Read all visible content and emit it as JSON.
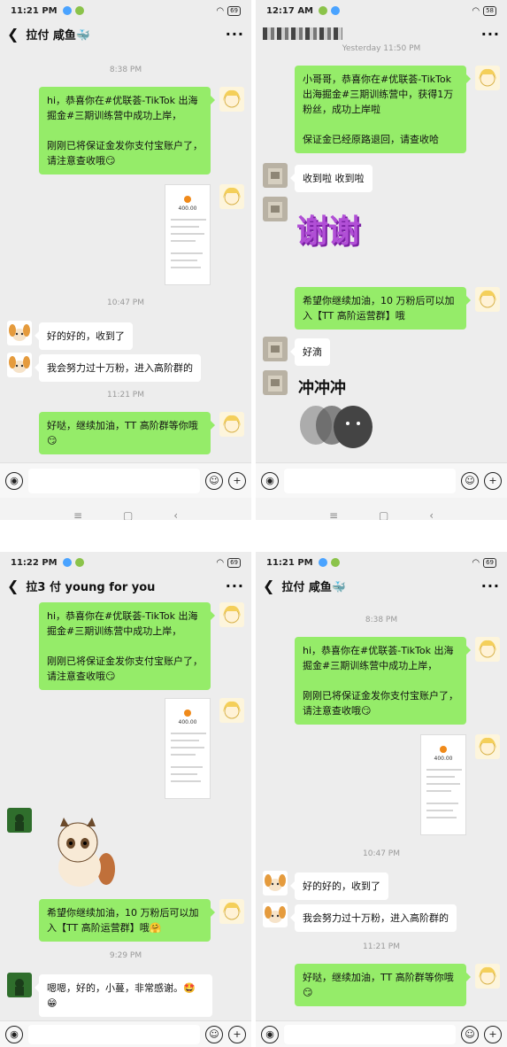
{
  "panel1": {
    "time": "11:21 PM",
    "battery": "69",
    "title": "拉付 咸鱼🐳",
    "ts1": "8:38 PM",
    "msg1_line1": "hi，恭喜你在#优联荟-TikTok 出海掘金#三期训练营中成功上岸，",
    "msg1_line2": "刚刚已将保证金发你支付宝账户了，请注意查收哦😏",
    "shot_amount": "400.00",
    "ts2": "10:47 PM",
    "reply1": "好的好的，收到了",
    "reply2": "我会努力过十万粉，进入高阶群的",
    "ts3": "11:21 PM",
    "msg2": "好哒，继续加油，TT 高阶群等你哦😏"
  },
  "panel2": {
    "time": "12:17 AM",
    "battery": "58",
    "ts0": "Yesterday 11:50 PM",
    "msg1_line1": "小哥哥，恭喜你在#优联荟-TikTok 出海掘金#三期训练营中，获得1万粉丝，成功上岸啦",
    "msg1_line2": "保证金已经原路退回，请查收哈",
    "reply1": "收到啦 收到啦",
    "sticker1": "谢谢",
    "msg2": "希望你继续加油，10 万粉后可以加入【TT 高阶运营群】哦",
    "reply2": "好滴",
    "sticker2": "冲冲冲"
  },
  "panel3": {
    "time": "11:22 PM",
    "battery": "69",
    "title": "拉3  付 young for you",
    "msg1_line1": "hi，恭喜你在#优联荟-TikTok 出海掘金#三期训练营中成功上岸，",
    "msg1_line2": "刚刚已将保证金发你支付宝账户了，请注意查收哦😏",
    "shot_amount": "400.00",
    "msg2": "希望你继续加油，10 万粉后可以加入【TT 高阶运营群】哦🤗",
    "ts1": "9:29 PM",
    "reply1": "嗯嗯，好的，小蔓，非常感谢。🤩😁"
  },
  "panel4": {
    "time": "11:21 PM",
    "battery": "69",
    "title": "拉付 咸鱼🐳",
    "ts1": "8:38 PM",
    "msg1_line1": "hi，恭喜你在#优联荟-TikTok 出海掘金#三期训练营中成功上岸，",
    "msg1_line2": "刚刚已将保证金发你支付宝账户了，请注意查收哦😏",
    "shot_amount": "400.00",
    "ts2": "10:47 PM",
    "reply1": "好的好的，收到了",
    "reply2": "我会努力过十万粉，进入高阶群的",
    "ts3": "11:21 PM",
    "msg2": "好哒，继续加油，TT 高阶群等你哦😏"
  },
  "icons": {
    "back": "chevron-left-icon",
    "more": "more-icon",
    "voice": "voice-icon",
    "emoji": "emoji-icon",
    "plus": "plus-icon",
    "nav_menu": "menu-icon",
    "nav_home": "home-icon",
    "nav_back": "nav-back-icon"
  },
  "colors": {
    "own_bubble": "#95ec69",
    "other_bubble": "#ffffff",
    "chat_bg": "#ededed"
  }
}
